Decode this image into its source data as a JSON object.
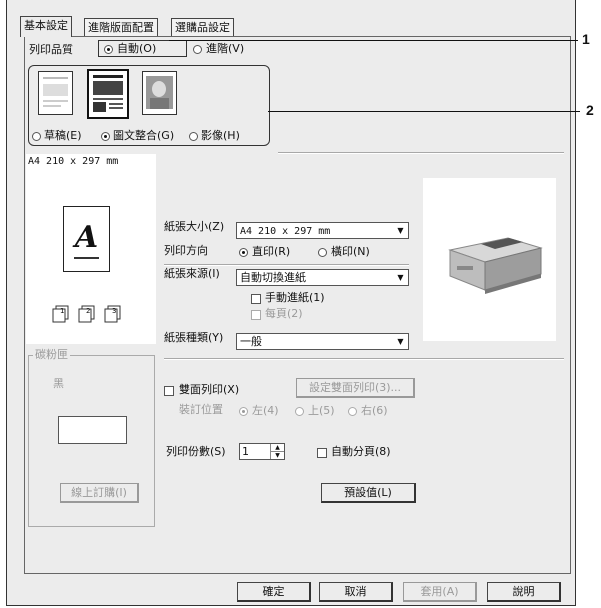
{
  "tabs": [
    "基本設定",
    "進階版面配置",
    "選購品設定"
  ],
  "print_quality": {
    "label": "列印品質",
    "auto": "自動(O)",
    "advanced": "進階(V)",
    "modes": [
      "草稿(E)",
      "圖文整合(G)",
      "影像(H)"
    ],
    "selected_mode": "圖文整合(G)"
  },
  "preview": {
    "paper_label": "A4 210 x 297 mm",
    "sample_letter": "A",
    "page_icons": [
      "1",
      "2",
      "3"
    ]
  },
  "toner": {
    "group_label": "碳粉匣",
    "color": "黑",
    "order_button": "線上訂購(I)"
  },
  "paper_size": {
    "label": "紙張大小(Z)",
    "value": "A4 210 x 297 mm"
  },
  "orientation": {
    "label": "列印方向",
    "portrait": "直印(R)",
    "landscape": "橫印(N)",
    "selected": "直印(R)"
  },
  "paper_source": {
    "label": "紙張來源(I)",
    "value": "自動切換進紙"
  },
  "manual_feed": "手動進紙(1)",
  "each_page": "每頁(2)",
  "paper_type": {
    "label": "紙張種類(Y)",
    "value": "一般"
  },
  "duplex": {
    "label": "雙面列印(X)",
    "settings_button": "設定雙面列印(3)...",
    "binding_label": "裝訂位置",
    "left": "左(4)",
    "top": "上(5)",
    "right": "右(6)"
  },
  "copies": {
    "label": "列印份數(S)",
    "value": "1"
  },
  "collate": "自動分頁(8)",
  "default_button": "預設值(L)",
  "footer": {
    "ok": "確定",
    "cancel": "取消",
    "apply": "套用(A)",
    "help": "說明"
  },
  "callouts": [
    "1",
    "2"
  ]
}
